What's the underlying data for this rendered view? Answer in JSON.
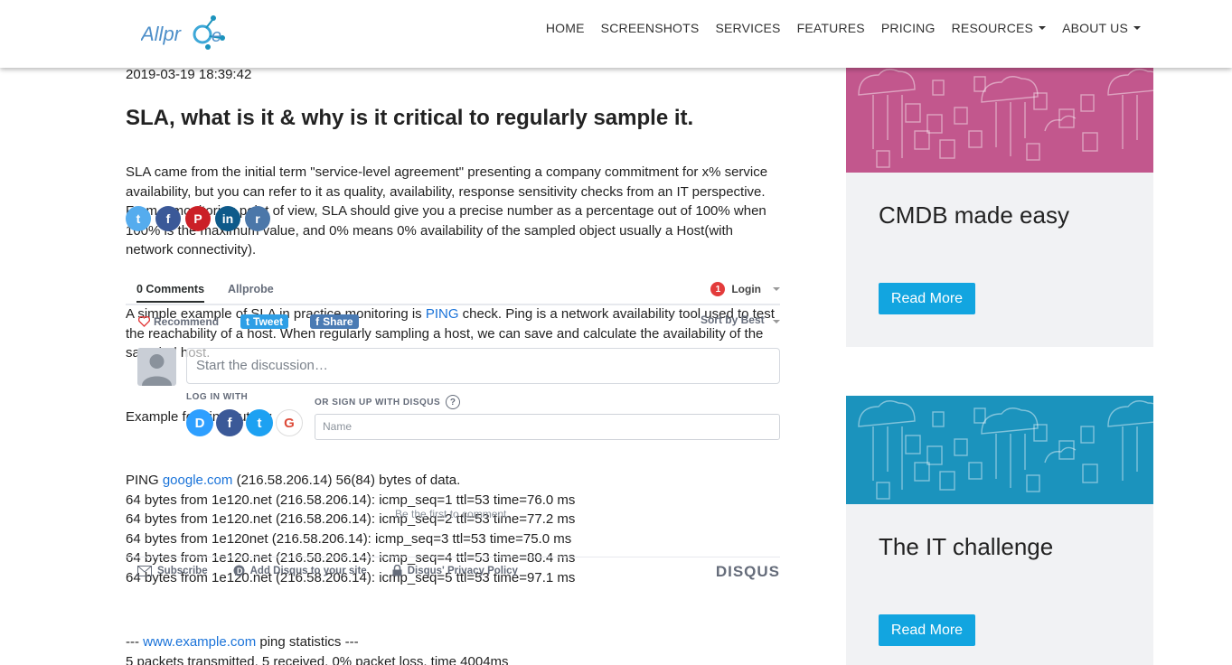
{
  "header": {
    "logo_text": "Allprobe",
    "nav": [
      {
        "label": "HOME",
        "dropdown": false
      },
      {
        "label": "SCREENSHOTS",
        "dropdown": false
      },
      {
        "label": "SERVICES",
        "dropdown": false
      },
      {
        "label": "FEATURES",
        "dropdown": false
      },
      {
        "label": "PRICING",
        "dropdown": false
      },
      {
        "label": "RESOURCES",
        "dropdown": true
      },
      {
        "label": "ABOUT US",
        "dropdown": true
      }
    ]
  },
  "article": {
    "date": "2019-03-19 18:39:42",
    "title": "SLA, what is it & why is it critical to regularly sample it.",
    "para1": "SLA came from the initial term \"service-level agreement\" presenting a company commitment for x% service availability, but you can refer to it as quality, availability, response sensitivity checks from an IT perspective. From a monitoring point of view, SLA should give you a precise number as a percentage out of 100% when 100% is the maximum value, and 0% means 0% availability of the sampled object usually a Host(with network connectivity).",
    "para2_before": "A simple example of SLA in practice monitoring is ",
    "para2_link": "PING",
    "para2_after": " check. Ping is a network availability tool used to test the reachability of a host. When regularly sampling a host, we can save and calculate the availability of the sampled host.",
    "para3": "Example for ping output:",
    "ping_prefix": "PING ",
    "ping_link": "google.com",
    "ping_suffix": " (216.58.206.14) 56(84) bytes of data.",
    "ping_lines": [
      "64 bytes from 1e120.net (216.58.206.14): icmp_seq=1 ttl=53 time=76.0 ms",
      "64 bytes from 1e120.net (216.58.206.14): icmp_seq=2 ttl=53 time=77.2 ms",
      "64 bytes from 1e120net (216.58.206.14): icmp_seq=3 ttl=53 time=75.0 ms",
      "64 bytes from 1e120.net (216.58.206.14): icmp_seq=4 ttl=53 time=80.4 ms",
      "64 bytes from 1e120.net (216.58.206.14): icmp_seq=5 ttl=53 time=97.1 ms"
    ],
    "stats_prefix": "--- ",
    "stats_link": "www.example.com",
    "stats_suffix": " ping statistics ---",
    "stats_line2": "5 packets transmitted, 5 received, 0% packet loss, time 4004ms"
  },
  "share_icons": [
    {
      "icon": "twitter-icon",
      "glyph": "t",
      "color": "#55acee"
    },
    {
      "icon": "facebook-icon",
      "glyph": "f",
      "color": "#3b5998"
    },
    {
      "icon": "pinterest-icon",
      "glyph": "P",
      "color": "#cb2027"
    },
    {
      "icon": "linkedin-icon",
      "glyph": "in",
      "color": "#0e5a8a"
    },
    {
      "icon": "reddit-icon",
      "glyph": "r",
      "color": "#4b77a9"
    }
  ],
  "disqus": {
    "tab_comments": "0 Comments",
    "tab_site": "Allprobe",
    "badge": "1",
    "login": "Login",
    "recommend": "Recommend",
    "tweet": "Tweet",
    "share": "Share",
    "sort": "Sort by Best",
    "placeholder": "Start the discussion…",
    "log_in_with": "LOG IN WITH",
    "sign_up": "OR SIGN UP WITH DISQUS",
    "help_glyph": "?",
    "name_placeholder": "Name",
    "be_first": "Be the first to comment.",
    "subscribe": "Subscribe",
    "add_disqus": "Add Disqus to your site",
    "privacy": "Disqus' Privacy Policy",
    "brand": "DISQUS",
    "login_icons": [
      {
        "icon": "disqus-icon",
        "glyph": "D",
        "color": "#2e9fff"
      },
      {
        "icon": "facebook-icon",
        "glyph": "f",
        "color": "#3b5998"
      },
      {
        "icon": "twitter-icon",
        "glyph": "t",
        "color": "#1da1f2"
      },
      {
        "icon": "google-icon",
        "glyph": "G",
        "color": "#dd4b39"
      }
    ]
  },
  "sidebar": {
    "cards": [
      {
        "title": "CMDB made easy",
        "button": "Read More",
        "color": "#c2578d"
      },
      {
        "title": "The IT challenge",
        "button": "Read More",
        "color": "#1b93bd"
      }
    ]
  }
}
